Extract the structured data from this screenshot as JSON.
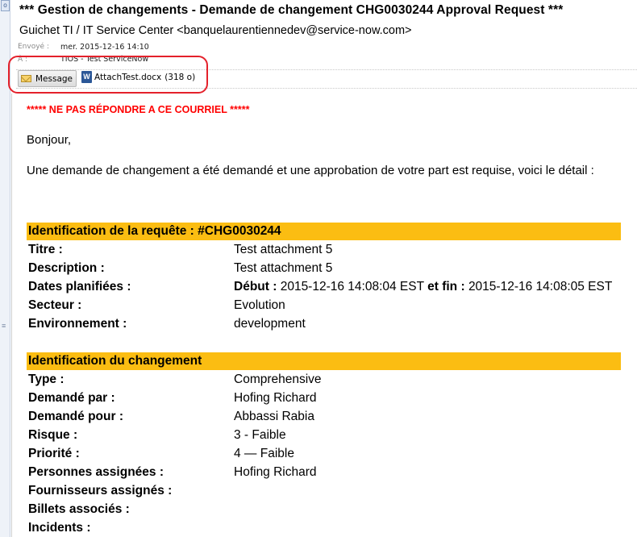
{
  "header": {
    "subject": "*** Gestion de changements - Demande de changement CHG0030244 Approval Request ***",
    "from": "Guichet TI / IT Service Center <banquelaurentiennedev@service-now.com>",
    "sent_label": "Envoyé :",
    "sent_value": "mer. 2015-12-16 14:10",
    "to_label": "À :",
    "to_value": "TIOS - Test ServiceNow"
  },
  "attachments": {
    "message_button": "Message",
    "file_name": "AttachTest.docx",
    "file_size": "(318 o)",
    "file_icon_letter": "W"
  },
  "body": {
    "warning": "***** NE PAS RÉPONDRE A CE COURRIEL *****",
    "greeting": "Bonjour,",
    "intro": "Une demande de changement a été demandé et une approbation de votre part est requise, voici le détail :"
  },
  "section1": {
    "title": "Identification de la requête : #CHG0030244",
    "rows": [
      {
        "label": "Titre :",
        "value": "Test attachment 5"
      },
      {
        "label": "Description :",
        "value": "Test attachment 5"
      },
      {
        "label": "Dates planifiées :",
        "start_label": "Début :",
        "start": "2015-12-16 14:08:04 EST",
        "end_label": "et fin :",
        "end": "2015-12-16 14:08:05 EST"
      },
      {
        "label": "Secteur :",
        "value": "Evolution"
      },
      {
        "label": "Environnement :",
        "value": "development"
      }
    ]
  },
  "section2": {
    "title": "Identification du changement",
    "rows": [
      {
        "label": "Type :",
        "value": "Comprehensive"
      },
      {
        "label": "Demandé par :",
        "value": "Hofing Richard"
      },
      {
        "label": "Demandé pour :",
        "value": "Abbassi Rabia"
      },
      {
        "label": "Risque :",
        "value": "3 - Faible"
      },
      {
        "label": "Priorité :",
        "value": "4 — Faible"
      },
      {
        "label": "Personnes assignées :",
        "value": "Hofing Richard"
      },
      {
        "label": "Fournisseurs assignés :",
        "value": ""
      },
      {
        "label": "Billets associés :",
        "value": ""
      },
      {
        "label": "Incidents :",
        "value": ""
      }
    ]
  },
  "colors": {
    "section_header": "#fbbd12",
    "warning_text": "#ff0000",
    "annotation_circle": "#e4212b"
  }
}
